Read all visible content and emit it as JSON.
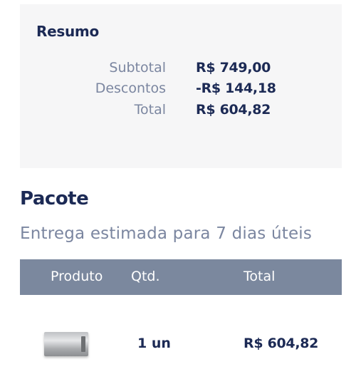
{
  "summary": {
    "title": "Resumo",
    "rows": [
      {
        "label": "Subtotal",
        "value": "R$ 749,00"
      },
      {
        "label": "Descontos",
        "value": "-R$ 144,18"
      },
      {
        "label": "Total",
        "value": "R$ 604,82"
      }
    ]
  },
  "package": {
    "title": "Pacote",
    "delivery": "Entrega estimada para 7 dias úteis",
    "table": {
      "headers": [
        "Produto",
        "Qtd.",
        "Total"
      ],
      "rows": [
        {
          "product_icon": "product-image",
          "qty": "1 un",
          "total": "R$ 604,82"
        }
      ]
    }
  },
  "colors": {
    "primary_text": "#1c2a55",
    "muted_text": "#7b86a0",
    "summary_bg": "#f6f6f7",
    "table_header_bg": "#7b889e"
  }
}
